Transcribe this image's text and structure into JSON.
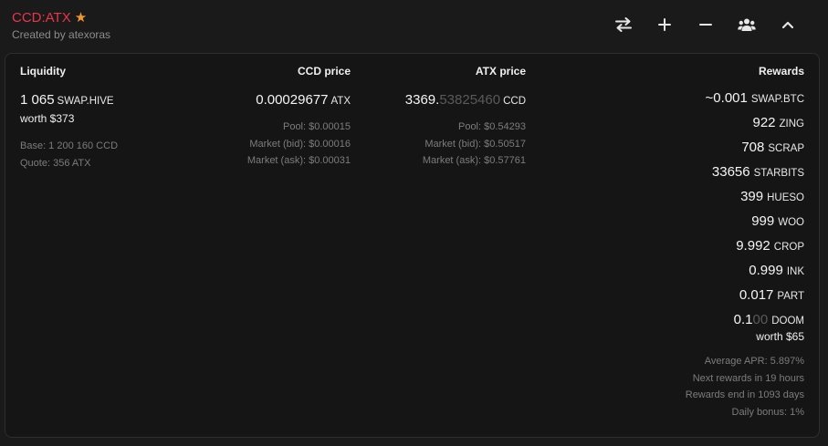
{
  "header": {
    "pair": "CCD:ATX",
    "favorite_icon": "star-icon",
    "subtitle": "Created by atexoras"
  },
  "toolbar": {
    "buttons": [
      {
        "name": "swap-button",
        "icon": "swap-arrows-icon"
      },
      {
        "name": "add-liquidity-button",
        "icon": "plus-icon"
      },
      {
        "name": "remove-liquidity-button",
        "icon": "minus-icon"
      },
      {
        "name": "users-button",
        "icon": "users-icon"
      },
      {
        "name": "collapse-button",
        "icon": "chevron-up-icon"
      }
    ]
  },
  "liquidity": {
    "header": "Liquidity",
    "amount": "1 065",
    "unit": "SWAP.HIVE",
    "worth": "worth $373",
    "base": "Base: 1 200 160 CCD",
    "quote": "Quote: 356 ATX"
  },
  "ccd_price": {
    "header": "CCD price",
    "value": "0.00029677",
    "unit": "ATX",
    "pool": "Pool: $0.00015",
    "market_bid": "Market (bid): $0.00016",
    "market_ask": "Market (ask): $0.00031"
  },
  "atx_price": {
    "header": "ATX price",
    "value_main": "3369.",
    "value_faded": "53825460",
    "unit": "CCD",
    "pool": "Pool: $0.54293",
    "market_bid": "Market (bid): $0.50517",
    "market_ask": "Market (ask): $0.57761"
  },
  "rewards": {
    "header": "Rewards",
    "items": [
      {
        "amount": "~0.001",
        "faded": "",
        "unit": "SWAP.BTC"
      },
      {
        "amount": "922",
        "faded": "",
        "unit": "ZING"
      },
      {
        "amount": "708",
        "faded": "",
        "unit": "SCRAP"
      },
      {
        "amount": "33656",
        "faded": "",
        "unit": "STARBITS"
      },
      {
        "amount": "399",
        "faded": "",
        "unit": "HUESO"
      },
      {
        "amount": "999",
        "faded": "",
        "unit": "WOO"
      },
      {
        "amount": "9.992",
        "faded": "",
        "unit": "CROP"
      },
      {
        "amount": "0.999",
        "faded": "",
        "unit": "INK"
      },
      {
        "amount": "0.017",
        "faded": "",
        "unit": "PART"
      },
      {
        "amount": "0.1",
        "faded": "00",
        "unit": "DOOM"
      }
    ],
    "worth": "worth $65",
    "average_apr": "Average APR: 5.897%",
    "next_rewards": "Next rewards in 19 hours",
    "rewards_end": "Rewards end in 1093 days",
    "daily_bonus": "Daily bonus: 1%"
  }
}
